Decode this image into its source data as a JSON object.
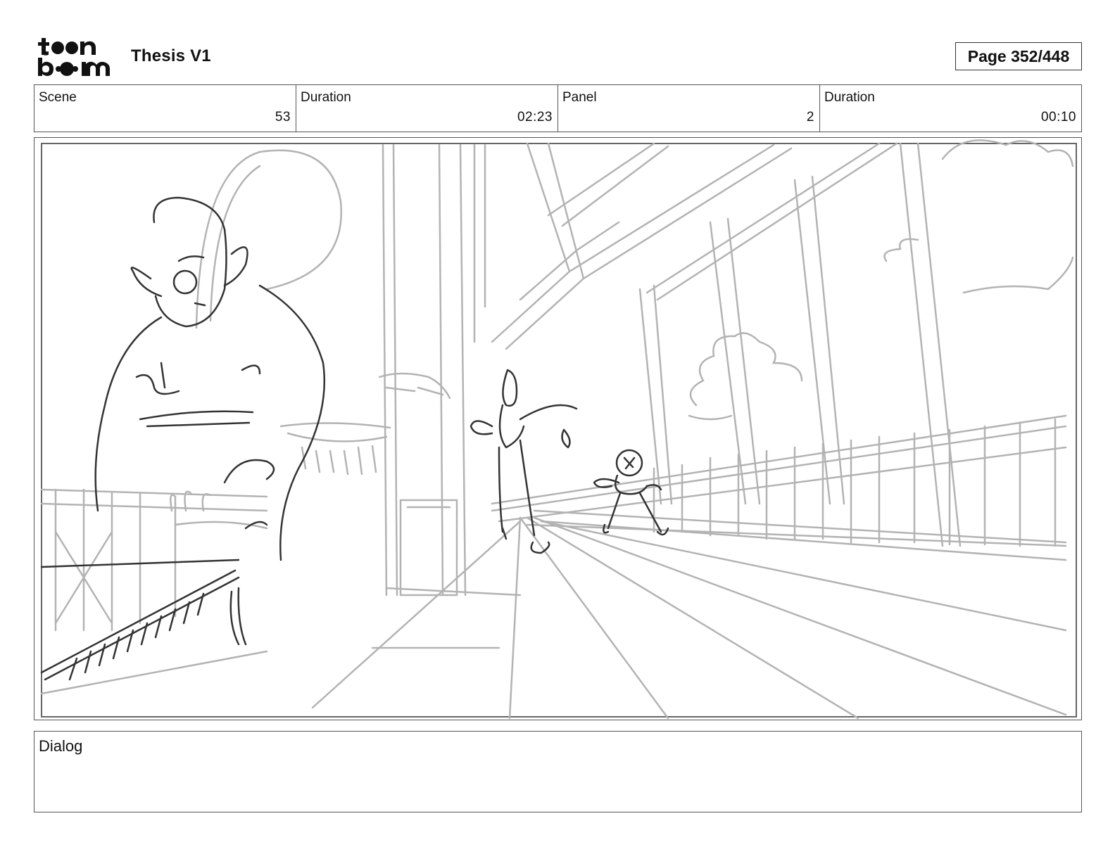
{
  "header": {
    "logo_text": "toonboom",
    "title": "Thesis V1",
    "page_indicator": "Page 352/448"
  },
  "info_row": [
    {
      "label": "Scene",
      "value": "53"
    },
    {
      "label": "Duration",
      "value": "02:23"
    },
    {
      "label": "Panel",
      "value": "2"
    },
    {
      "label": "Duration",
      "value": "00:10"
    }
  ],
  "panel": {
    "sketch_colors": {
      "background_lines": "#b3b3b3",
      "character_lines": "#333333"
    }
  },
  "dialog": {
    "label": "Dialog",
    "text": ""
  }
}
